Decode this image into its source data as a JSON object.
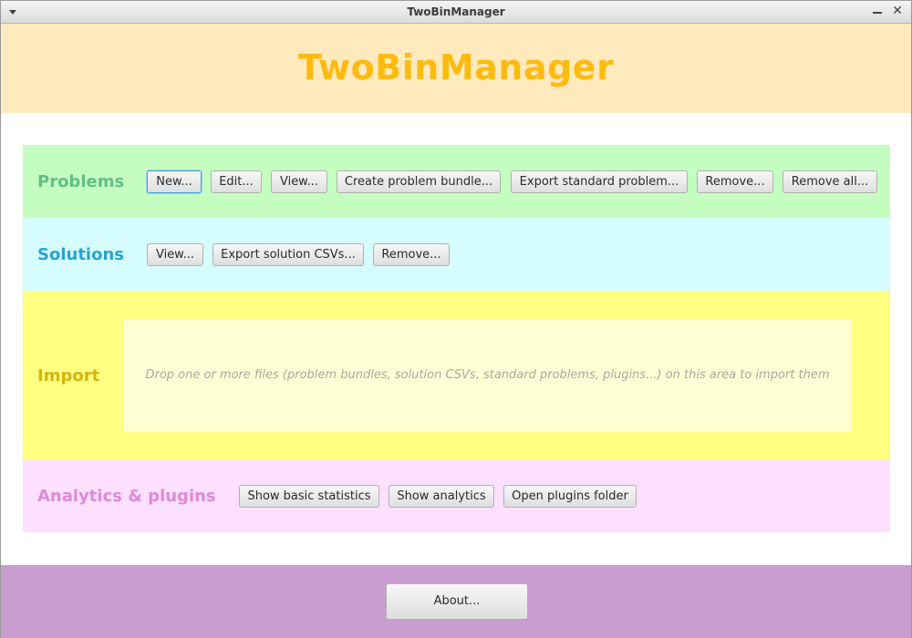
{
  "window": {
    "title": "TwoBinManager"
  },
  "header": {
    "app_title": "TwoBinManager",
    "color": "#fdbb10"
  },
  "problems": {
    "label": "Problems",
    "buttons": [
      "New...",
      "Edit...",
      "View...",
      "Create problem bundle...",
      "Export standard problem...",
      "Remove...",
      "Remove all..."
    ]
  },
  "solutions": {
    "label": "Solutions",
    "buttons": [
      "View...",
      "Export solution CSVs...",
      "Remove..."
    ]
  },
  "import": {
    "label": "Import",
    "drop_text": "Drop one or more files (problem bundles, solution CSVs, standard problems, plugins...) on this area to import them"
  },
  "analytics": {
    "label": "Analytics & plugins",
    "buttons": [
      "Show basic statistics",
      "Show analytics",
      "Open plugins folder"
    ]
  },
  "footer": {
    "about_label": "About..."
  },
  "colors": {
    "header_bg": "#ffe9bd",
    "problems_bg": "#c5fdc1",
    "solutions_bg": "#d5fdfd",
    "import_bg": "#fefe80",
    "analytics_bg": "#fde0fd",
    "footer_bg": "#c99dcf"
  }
}
